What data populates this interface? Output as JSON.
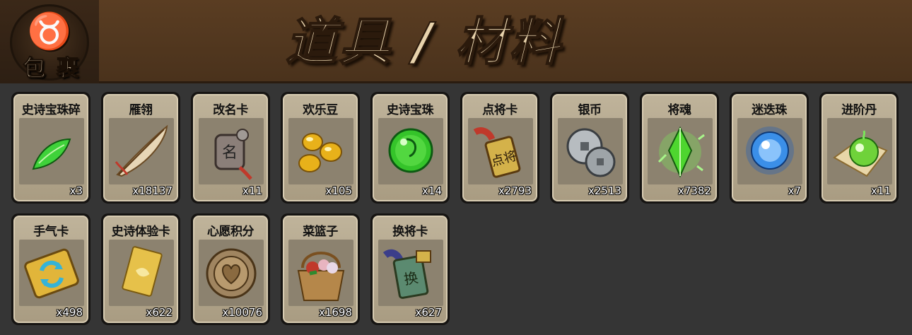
{
  "header": {
    "bag_label": "包 裹",
    "title": "道具 / 材料",
    "bag_icon": "money-bag-icon"
  },
  "items": [
    {
      "name": "史诗宝珠碎",
      "count": "x3",
      "icon": "green-leaf-shard-icon",
      "color": "#3fd23a"
    },
    {
      "name": "雁翎",
      "count": "x18137",
      "icon": "feather-icon",
      "color": "#b08a4e"
    },
    {
      "name": "改名卡",
      "count": "x11",
      "icon": "name-token-icon",
      "color": "#9a8f88"
    },
    {
      "name": "欢乐豆",
      "count": "x105",
      "icon": "gold-beans-icon",
      "color": "#e8b11a"
    },
    {
      "name": "史诗宝珠",
      "count": "x14",
      "icon": "green-orb-icon",
      "color": "#35c42a"
    },
    {
      "name": "点将卡",
      "count": "x2793",
      "icon": "general-card-icon",
      "color": "#d4b24a"
    },
    {
      "name": "银币",
      "count": "x2513",
      "icon": "silver-coins-icon",
      "color": "#b7bcc0"
    },
    {
      "name": "将魂",
      "count": "x7382",
      "icon": "green-crystal-icon",
      "color": "#4ed62f"
    },
    {
      "name": "迷迭珠",
      "count": "x7",
      "icon": "blue-orb-icon",
      "color": "#3b8fe8"
    },
    {
      "name": "进阶丹",
      "count": "x11",
      "icon": "green-pill-icon",
      "color": "#6fd23a"
    },
    {
      "name": "手气卡",
      "count": "x498",
      "icon": "refresh-card-icon",
      "color": "#35b3d8"
    },
    {
      "name": "史诗体验卡",
      "count": "x622",
      "icon": "gold-card-icon",
      "color": "#e6c14a"
    },
    {
      "name": "心愿积分",
      "count": "x10076",
      "icon": "heart-coin-icon",
      "color": "#a08560"
    },
    {
      "name": "菜篮子",
      "count": "x1698",
      "icon": "basket-icon",
      "color": "#b5874a"
    },
    {
      "name": "换将卡",
      "count": "x627",
      "icon": "swap-general-card-icon",
      "color": "#5b8a70"
    }
  ]
}
